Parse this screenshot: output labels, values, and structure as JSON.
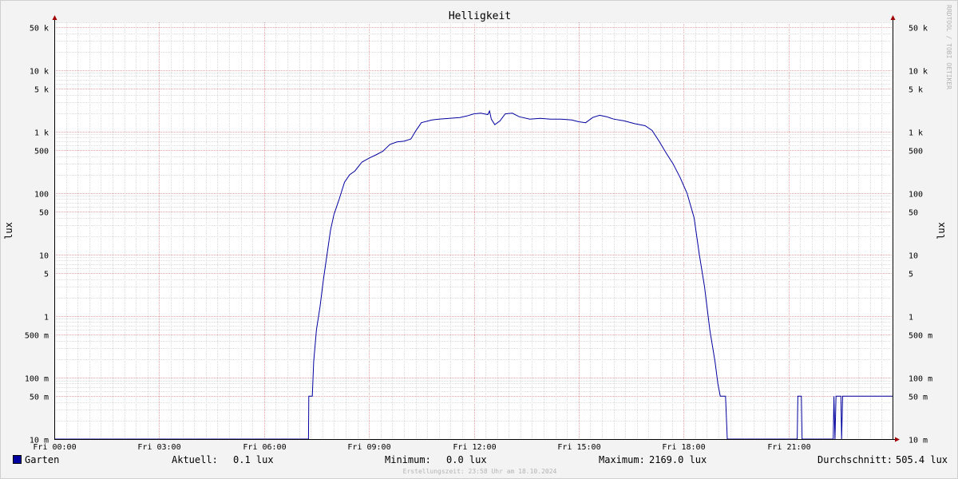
{
  "chart_data": {
    "type": "line",
    "title": "Helligkeit",
    "ylabel": "lux",
    "yscale": "log",
    "ylim": [
      0.01,
      60000
    ],
    "xlim": [
      0,
      24
    ],
    "grid": true,
    "x_ticks": [
      {
        "value": 0,
        "label": "Fri 00:00"
      },
      {
        "value": 3,
        "label": "Fri 03:00"
      },
      {
        "value": 6,
        "label": "Fri 06:00"
      },
      {
        "value": 9,
        "label": "Fri 09:00"
      },
      {
        "value": 12,
        "label": "Fri 12:00"
      },
      {
        "value": 15,
        "label": "Fri 15:00"
      },
      {
        "value": 18,
        "label": "Fri 18:00"
      },
      {
        "value": 21,
        "label": "Fri 21:00"
      }
    ],
    "y_ticks": [
      {
        "value": 50000,
        "label": "50 k"
      },
      {
        "value": 10000,
        "label": "10 k"
      },
      {
        "value": 5000,
        "label": "5 k"
      },
      {
        "value": 1000,
        "label": "1 k"
      },
      {
        "value": 500,
        "label": "500"
      },
      {
        "value": 100,
        "label": "100"
      },
      {
        "value": 50,
        "label": "50"
      },
      {
        "value": 10,
        "label": "10"
      },
      {
        "value": 5,
        "label": "5"
      },
      {
        "value": 1,
        "label": "1"
      },
      {
        "value": 0.5,
        "label": "500 m"
      },
      {
        "value": 0.1,
        "label": "100 m"
      },
      {
        "value": 0.05,
        "label": "50 m"
      },
      {
        "value": 0.01,
        "label": "10 m"
      }
    ],
    "series": [
      {
        "name": "Garten",
        "color": "#0000a0",
        "points": [
          [
            0,
            0.01
          ],
          [
            7.27,
            0.01
          ],
          [
            7.28,
            0.05
          ],
          [
            7.38,
            0.05
          ],
          [
            7.42,
            0.18
          ],
          [
            7.5,
            0.6
          ],
          [
            7.6,
            1.4
          ],
          [
            7.7,
            4
          ],
          [
            7.8,
            10
          ],
          [
            7.9,
            25
          ],
          [
            8.0,
            45
          ],
          [
            8.15,
            80
          ],
          [
            8.3,
            150
          ],
          [
            8.45,
            200
          ],
          [
            8.6,
            230
          ],
          [
            8.8,
            320
          ],
          [
            9.0,
            370
          ],
          [
            9.2,
            420
          ],
          [
            9.4,
            480
          ],
          [
            9.6,
            620
          ],
          [
            9.8,
            680
          ],
          [
            10.0,
            700
          ],
          [
            10.2,
            760
          ],
          [
            10.35,
            1050
          ],
          [
            10.5,
            1400
          ],
          [
            10.8,
            1550
          ],
          [
            11.0,
            1600
          ],
          [
            11.3,
            1650
          ],
          [
            11.6,
            1700
          ],
          [
            11.8,
            1800
          ],
          [
            12.0,
            1950
          ],
          [
            12.2,
            2000
          ],
          [
            12.4,
            1900
          ],
          [
            12.45,
            2169
          ],
          [
            12.5,
            1600
          ],
          [
            12.6,
            1300
          ],
          [
            12.75,
            1500
          ],
          [
            12.9,
            1950
          ],
          [
            13.1,
            2000
          ],
          [
            13.3,
            1750
          ],
          [
            13.6,
            1600
          ],
          [
            13.9,
            1650
          ],
          [
            14.2,
            1600
          ],
          [
            14.5,
            1600
          ],
          [
            14.8,
            1550
          ],
          [
            15.0,
            1450
          ],
          [
            15.2,
            1400
          ],
          [
            15.4,
            1700
          ],
          [
            15.6,
            1850
          ],
          [
            15.8,
            1750
          ],
          [
            16.0,
            1600
          ],
          [
            16.3,
            1500
          ],
          [
            16.6,
            1350
          ],
          [
            16.9,
            1250
          ],
          [
            17.1,
            1050
          ],
          [
            17.3,
            700
          ],
          [
            17.5,
            450
          ],
          [
            17.7,
            300
          ],
          [
            17.9,
            180
          ],
          [
            18.1,
            100
          ],
          [
            18.3,
            40
          ],
          [
            18.45,
            10
          ],
          [
            18.6,
            3
          ],
          [
            18.75,
            0.6
          ],
          [
            18.9,
            0.18
          ],
          [
            18.98,
            0.08
          ],
          [
            19.05,
            0.05
          ],
          [
            19.2,
            0.05
          ],
          [
            19.25,
            0.01
          ],
          [
            21.25,
            0.01
          ],
          [
            21.27,
            0.05
          ],
          [
            21.37,
            0.05
          ],
          [
            21.39,
            0.01
          ],
          [
            22.28,
            0.01
          ],
          [
            22.3,
            0.05
          ],
          [
            22.33,
            0.01
          ],
          [
            22.36,
            0.05
          ],
          [
            22.5,
            0.05
          ],
          [
            22.52,
            0.01
          ],
          [
            22.55,
            0.05
          ],
          [
            24,
            0.05
          ]
        ]
      }
    ]
  },
  "legend": {
    "series_name": "Garten",
    "current_label": "Aktuell:",
    "current_value": "0.1 lux",
    "min_label": "Minimum:",
    "min_value": "0.0 lux",
    "max_label": "Maximum:",
    "max_value": "2169.0 lux",
    "avg_label": "Durchschnitt:",
    "avg_value": "505.4 lux"
  },
  "footer": "Erstellungszeit: 23:58 Uhr am 18.10.2024",
  "watermark": "RRDTOOL / TOBI OETIKER"
}
